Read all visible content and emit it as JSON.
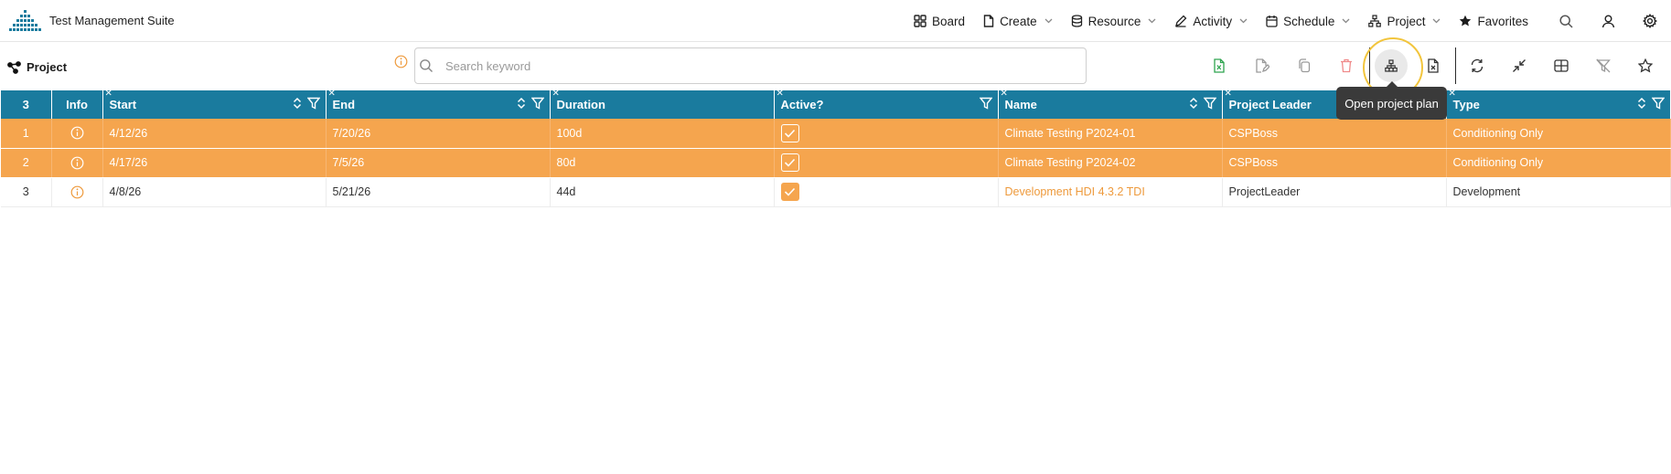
{
  "app": {
    "title": "Test Management Suite"
  },
  "nav": {
    "items": [
      {
        "label": "Board",
        "icon": "board-grid-icon",
        "dropdown": false
      },
      {
        "label": "Create",
        "icon": "file-icon",
        "dropdown": true
      },
      {
        "label": "Resource",
        "icon": "database-icon",
        "dropdown": true
      },
      {
        "label": "Activity",
        "icon": "pencil-icon",
        "dropdown": true
      },
      {
        "label": "Schedule",
        "icon": "calendar-icon",
        "dropdown": true
      },
      {
        "label": "Project",
        "icon": "hierarchy-icon",
        "dropdown": true
      },
      {
        "label": "Favorites",
        "icon": "star-icon",
        "dropdown": false
      }
    ],
    "icons": [
      "search-icon",
      "user-icon",
      "gear-icon"
    ]
  },
  "page": {
    "title": "Project"
  },
  "search": {
    "placeholder": "Search keyword",
    "value": ""
  },
  "tooltip": {
    "text": "Open project plan"
  },
  "colors": {
    "header": "#1a7b9e",
    "selected_row": "#f5a54e",
    "accent": "#ee9a3c",
    "ring": "#f2c53d"
  },
  "grid": {
    "count": "3",
    "columns": [
      "Info",
      "Start",
      "End",
      "Duration",
      "Active?",
      "Name",
      "Project Leader",
      "Type"
    ],
    "rows": [
      {
        "num": "1",
        "start": "4/12/26",
        "end": "7/20/26",
        "duration": "100d",
        "active": true,
        "name": "Climate Testing P2024-01",
        "leader": "CSPBoss",
        "type": "Conditioning Only",
        "selected": true
      },
      {
        "num": "2",
        "start": "4/17/26",
        "end": "7/5/26",
        "duration": "80d",
        "active": true,
        "name": "Climate Testing P2024-02",
        "leader": "CSPBoss",
        "type": "Conditioning Only",
        "selected": true
      },
      {
        "num": "3",
        "start": "4/8/26",
        "end": "5/21/26",
        "duration": "44d",
        "active": true,
        "name": "Development HDI 4.3.2 TDI",
        "leader": "ProjectLeader",
        "type": "Development",
        "selected": false
      }
    ]
  }
}
